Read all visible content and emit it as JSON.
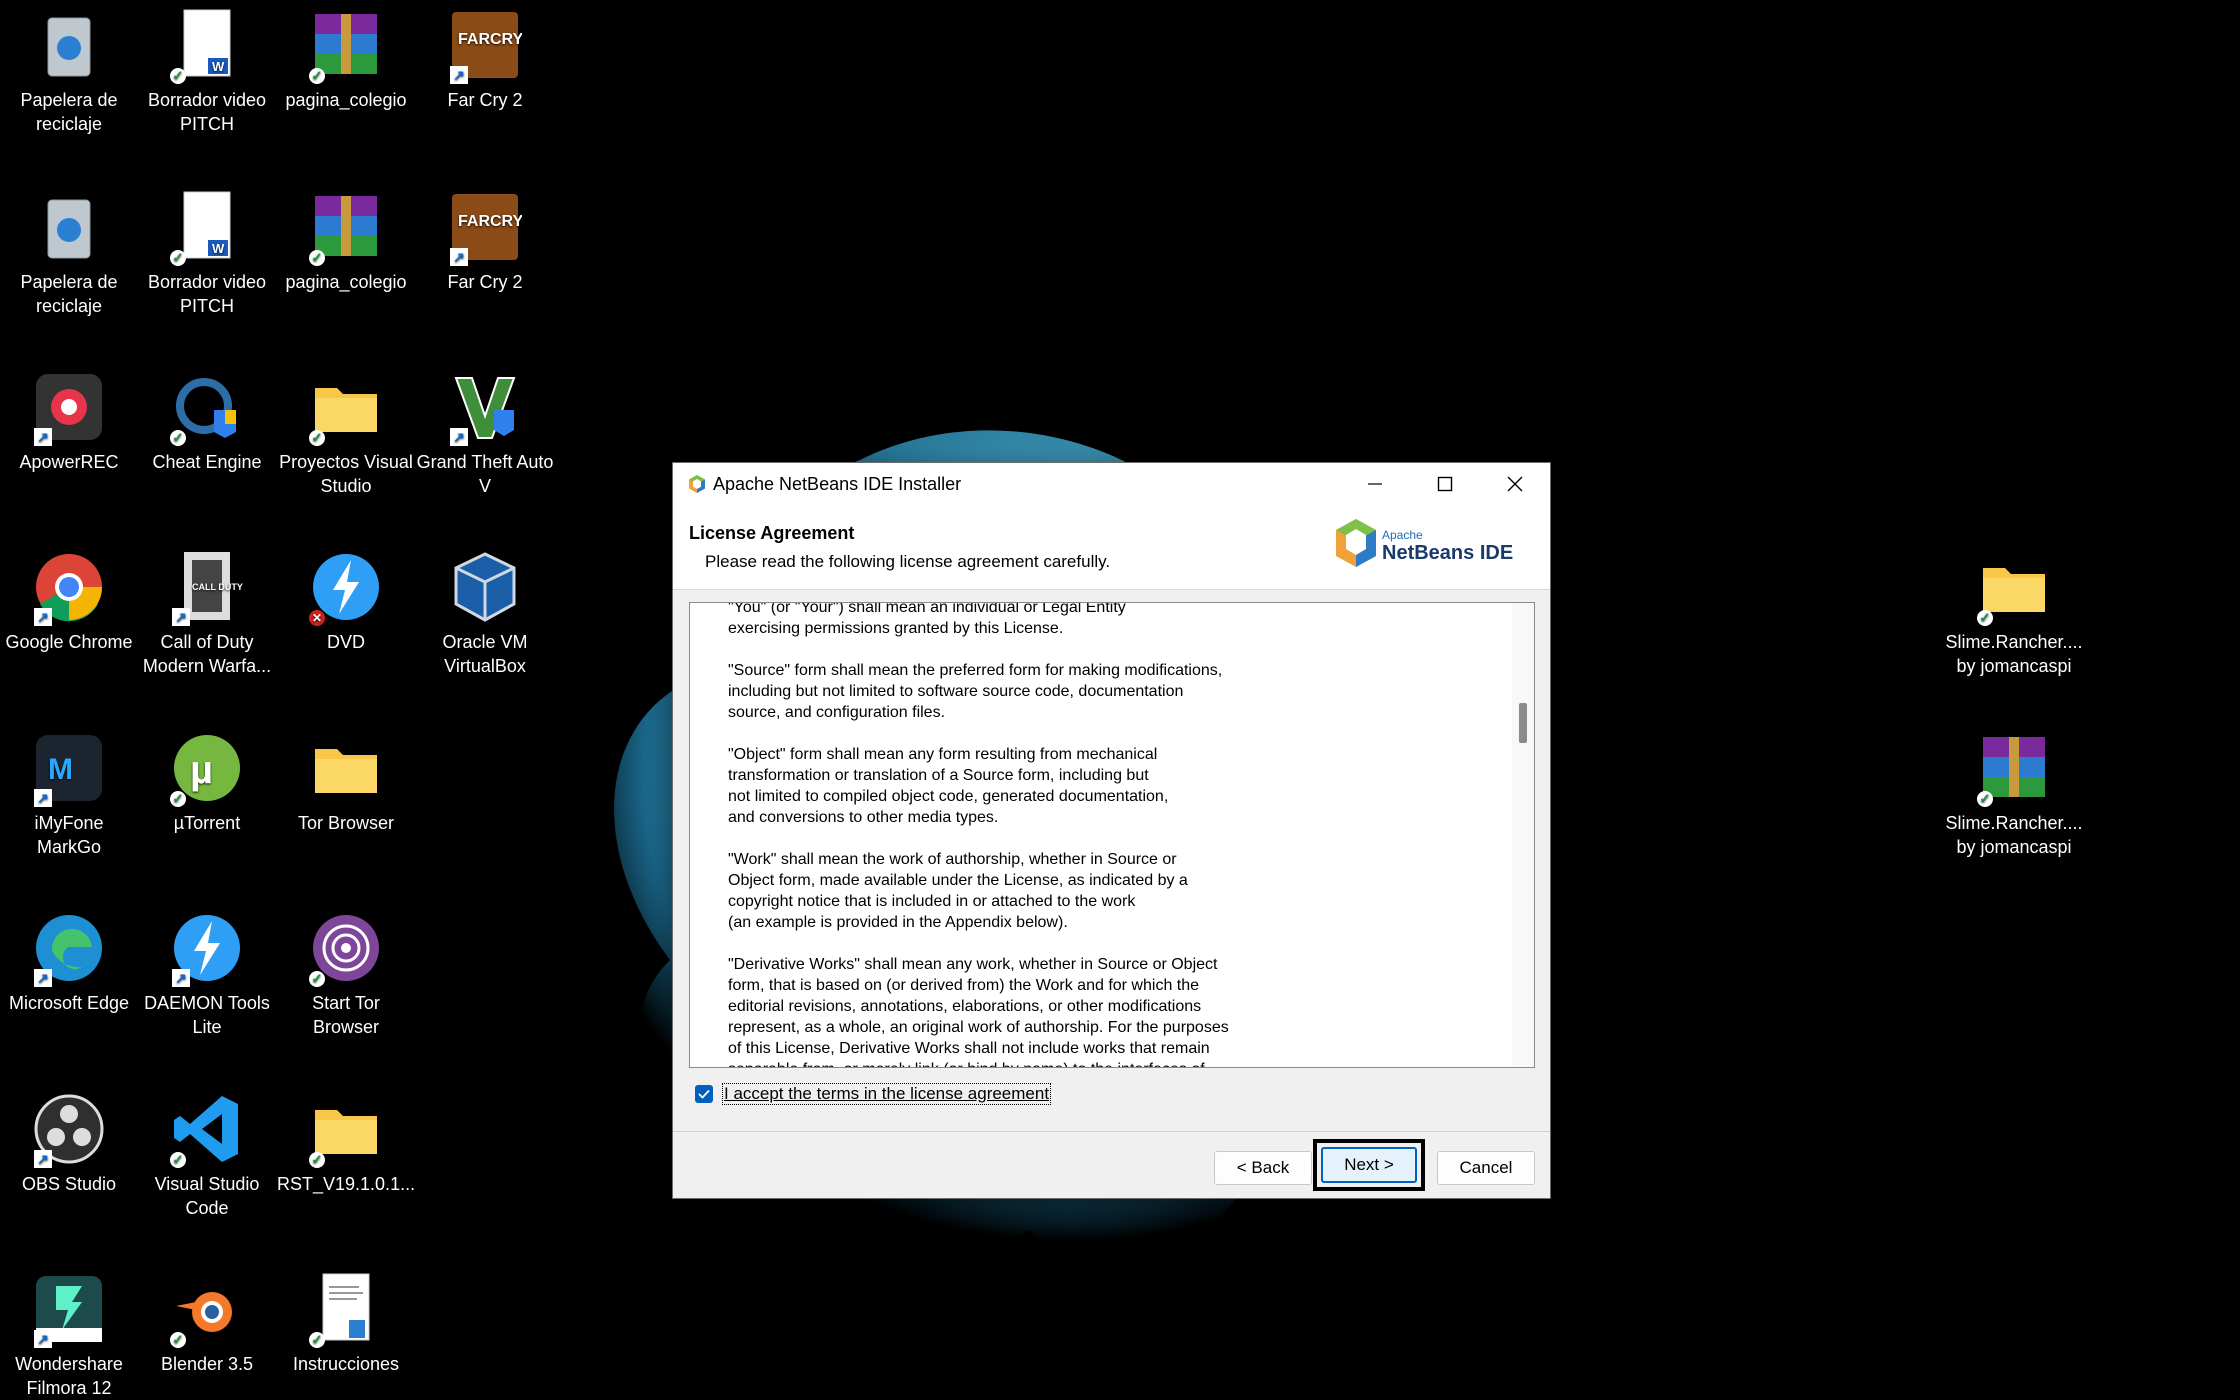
{
  "desktop": {
    "icons": [
      {
        "label": "Papelera de reciclaje",
        "icon": "recycle-bin-icon"
      },
      {
        "label": "Borrador video PITCH",
        "icon": "word-document-icon"
      },
      {
        "label": "pagina_colegio",
        "icon": "winrar-archive-icon"
      },
      {
        "label": "Far Cry 2",
        "icon": "far-cry-2-icon"
      },
      {
        "label": "Papelera de reciclaje",
        "icon": "recycle-bin-icon"
      },
      {
        "label": "Borrador video PITCH",
        "icon": "word-document-icon"
      },
      {
        "label": "pagina_colegio",
        "icon": "winrar-archive-icon"
      },
      {
        "label": "Far Cry 2",
        "icon": "far-cry-2-icon"
      },
      {
        "label": "ApowerREC",
        "icon": "apowerrec-icon"
      },
      {
        "label": "Cheat Engine",
        "icon": "cheat-engine-icon"
      },
      {
        "label": "Proyectos Visual Studio",
        "icon": "folder-icon"
      },
      {
        "label": "Grand Theft Auto V",
        "icon": "gta-v-icon"
      },
      {
        "label": "Google Chrome",
        "icon": "chrome-icon"
      },
      {
        "label": "Call of Duty Modern Warfa...",
        "icon": "call-of-duty-icon"
      },
      {
        "label": "DVD",
        "icon": "daemon-tools-icon"
      },
      {
        "label": "Oracle VM VirtualBox",
        "icon": "virtualbox-icon"
      },
      {
        "label": "iMyFone MarkGo",
        "icon": "markgo-icon"
      },
      {
        "label": "µTorrent",
        "icon": "utorrent-icon"
      },
      {
        "label": "Tor Browser",
        "icon": "folder-icon"
      },
      {
        "label": "Microsoft Edge",
        "icon": "edge-icon"
      },
      {
        "label": "DAEMON Tools Lite",
        "icon": "daemon-tools-icon"
      },
      {
        "label": "Start Tor Browser",
        "icon": "tor-browser-icon"
      },
      {
        "label": "OBS Studio",
        "icon": "obs-icon"
      },
      {
        "label": "Visual Studio Code",
        "icon": "vscode-icon"
      },
      {
        "label": "RST_V19.1.0.1...",
        "icon": "folder-icon"
      },
      {
        "label": "Wondershare Filmora 12",
        "icon": "filmora-icon"
      },
      {
        "label": "Blender 3.5",
        "icon": "blender-icon"
      },
      {
        "label": "Instrucciones",
        "icon": "text-document-icon"
      },
      {
        "label": "Slime.Rancher.... by jomancaspi",
        "icon": "folder-icon"
      },
      {
        "label": "Slime.Rancher.... by jomancaspi",
        "icon": "winrar-archive-icon"
      }
    ]
  },
  "installer": {
    "window_title": "Apache NetBeans IDE Installer",
    "header_title": "License Agreement",
    "header_subtitle": "Please read the following license agreement carefully.",
    "logo_small": "Apache",
    "logo_big": "NetBeans IDE",
    "license_text": "\"You\" (or \"Your\") shall mean an individual or Legal Entity\nexercising permissions granted by this License.\n\n\"Source\" form shall mean the preferred form for making modifications,\nincluding but not limited to software source code, documentation\nsource, and configuration files.\n\n\"Object\" form shall mean any form resulting from mechanical\ntransformation or translation of a Source form, including but\nnot limited to compiled object code, generated documentation,\nand conversions to other media types.\n\n\"Work\" shall mean the work of authorship, whether in Source or\nObject form, made available under the License, as indicated by a\ncopyright notice that is included in or attached to the work\n(an example is provided in the Appendix below).\n\n\"Derivative Works\" shall mean any work, whether in Source or Object\nform, that is based on (or derived from) the Work and for which the\neditorial revisions, annotations, elaborations, or other modifications\nrepresent, as a whole, an original work of authorship. For the purposes\nof this License, Derivative Works shall not include works that remain\nseparable from, or merely link (or bind by name) to the interfaces of,",
    "accept_label": "I accept the terms in the license agreement",
    "accept_checked": true,
    "back_label": "< Back",
    "next_label": "Next >",
    "cancel_label": "Cancel"
  }
}
